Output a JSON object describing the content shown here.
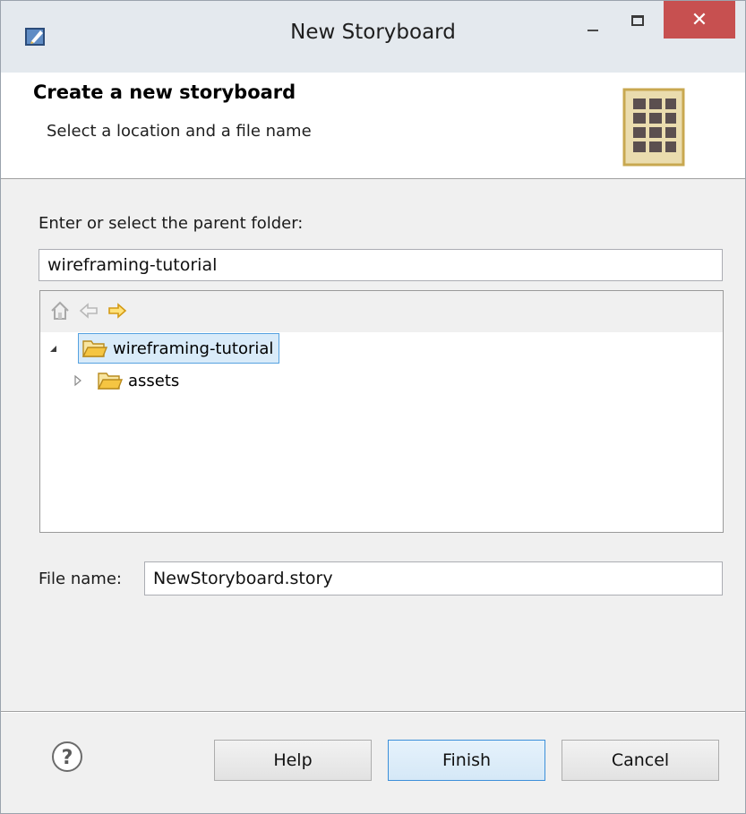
{
  "window": {
    "title": "New Storyboard",
    "close_glyph": "✕"
  },
  "banner": {
    "title": "Create a new storyboard",
    "subtitle": "Select a location and a file name",
    "icon": "storyboard-grid-icon"
  },
  "parent_folder": {
    "label": "Enter or select the parent folder:",
    "value": "wireframing-tutorial"
  },
  "tree": {
    "toolbar_icons": [
      "home-icon",
      "back-arrow-icon",
      "forward-arrow-icon"
    ],
    "items": [
      {
        "label": "wireframing-tutorial",
        "expanded": true,
        "selected": true,
        "level": 0
      },
      {
        "label": "assets",
        "expanded": false,
        "selected": false,
        "level": 1
      }
    ]
  },
  "file_name": {
    "label": "File name:",
    "value": "NewStoryboard.story"
  },
  "buttons": {
    "help": "Help",
    "finish": "Finish",
    "cancel": "Cancel"
  },
  "colors": {
    "close_button": "#c75050",
    "selection_fill": "#d9ebf9",
    "selection_border": "#56a2e0",
    "folder_yellow": "#f5c542"
  }
}
